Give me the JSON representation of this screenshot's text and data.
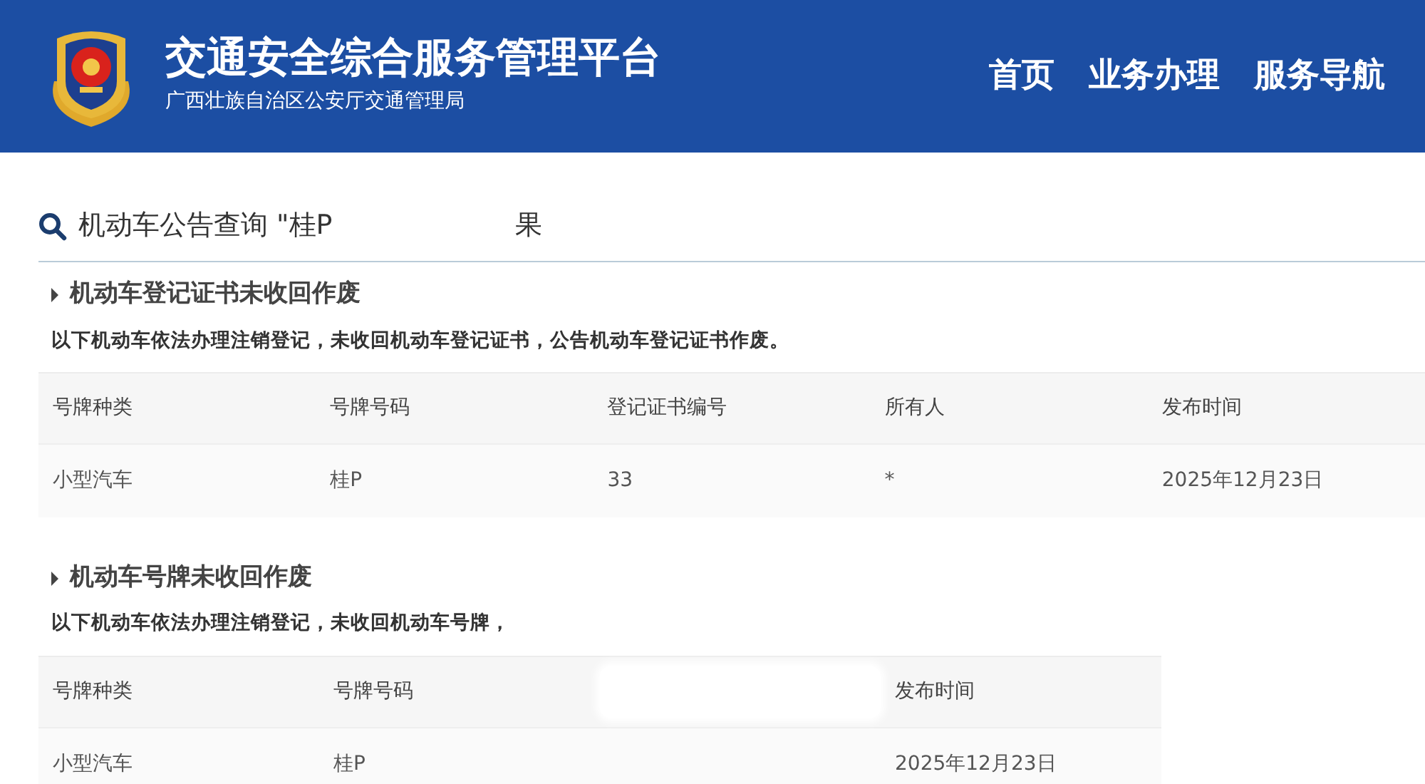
{
  "header": {
    "title": "交通安全综合服务管理平台",
    "subtitle": "广西壮族自治区公安厅交通管理局",
    "nav": [
      {
        "label": "首页"
      },
      {
        "label": "业务办理"
      },
      {
        "label": "服务导航"
      }
    ]
  },
  "search": {
    "query_start": "机动车公告查询 \"桂P",
    "query_end": "果"
  },
  "sections": [
    {
      "heading": "机动车登记证书未收回作废",
      "description": "以下机动车依法办理注销登记，未收回机动车登记证书，公告机动车登记证书作废。",
      "wide": true,
      "columns": [
        {
          "label": "号牌种类"
        },
        {
          "label": "号牌号码"
        },
        {
          "label": "登记证书编号"
        },
        {
          "label": "所有人"
        },
        {
          "label": "发布时间"
        }
      ],
      "rows": [
        [
          {
            "text": "小型汽车"
          },
          {
            "text": "桂P"
          },
          {
            "text": "33"
          },
          {
            "text": "*"
          },
          {
            "text": "2025年12月23日"
          }
        ]
      ]
    },
    {
      "heading": "机动车号牌未收回作废",
      "description": "以下机动车依法办理注销登记，未收回机动车号牌，",
      "wide": false,
      "columns": [
        {
          "label": "号牌种类"
        },
        {
          "label": "号牌号码"
        },
        {
          "redacted": true
        },
        {
          "label": "发布时间"
        }
      ],
      "rows": [
        [
          {
            "text": "小型汽车"
          },
          {
            "text": "桂P"
          },
          {
            "text": "2025年12月23日"
          }
        ]
      ]
    }
  ]
}
